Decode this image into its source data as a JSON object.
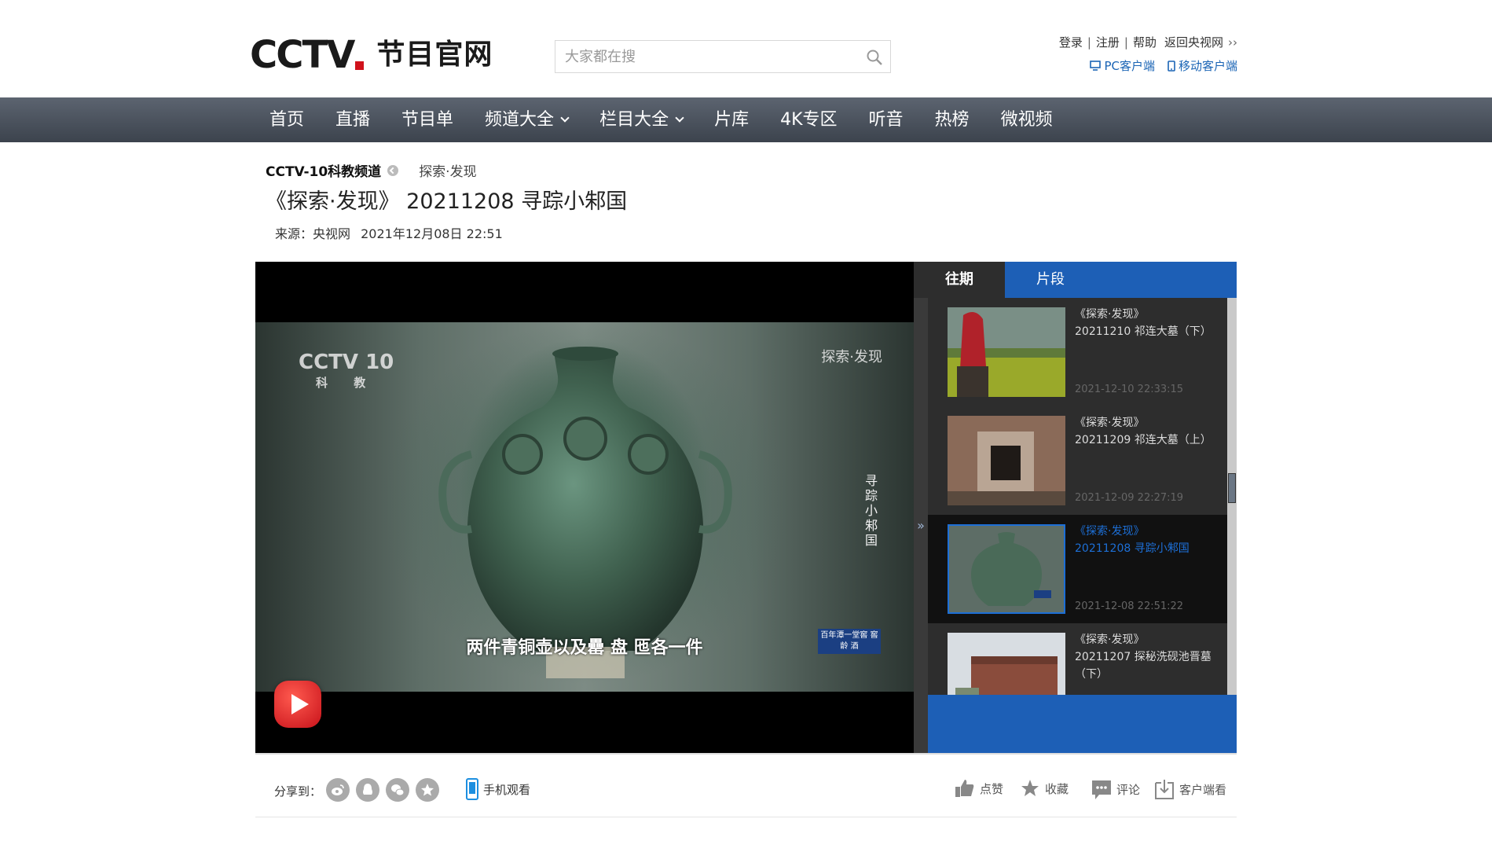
{
  "header": {
    "logo_text": "CCTV",
    "logo_sub": "节目官网",
    "search_placeholder": "大家都在搜",
    "links": {
      "login": "登录",
      "register": "注册",
      "help": "帮助",
      "back": "返回央视网"
    },
    "client_links": {
      "pc": "PC客户端",
      "mobile": "移动客户端"
    }
  },
  "nav": {
    "items": [
      {
        "label": "首页",
        "dropdown": false
      },
      {
        "label": "直播",
        "dropdown": false
      },
      {
        "label": "节目单",
        "dropdown": false
      },
      {
        "label": "频道大全",
        "dropdown": true
      },
      {
        "label": "栏目大全",
        "dropdown": true
      },
      {
        "label": "片库",
        "dropdown": false
      },
      {
        "label": "4K专区",
        "dropdown": false
      },
      {
        "label": "听音",
        "dropdown": false
      },
      {
        "label": "热榜",
        "dropdown": false
      },
      {
        "label": "微视频",
        "dropdown": false
      }
    ]
  },
  "page": {
    "channel": "CCTV-10科教频道",
    "column": "探索·发现",
    "title": "《探索·发现》 20211208 寻踪小邾国",
    "source": "来源：央视网",
    "date": "2021年12月08日 22:51"
  },
  "video": {
    "channel_logo": "CCTV 10",
    "channel_logo_sub": "科 教",
    "program_logo": "探索·发现",
    "vertical_title": "寻踪小邾国",
    "subtitle": "两件青铜壶以及罍 盘 匜各一件",
    "ad_text": "百年潭一堂窖 窖 龄 酒"
  },
  "sidebar": {
    "tabs": [
      {
        "label": "往期",
        "active": true
      },
      {
        "label": "片段",
        "active": false
      }
    ],
    "episodes": [
      {
        "series": "《探索·发现》",
        "title": "20211210 祁连大墓（下）",
        "time": "2021-12-10 22:33:15",
        "active": false
      },
      {
        "series": "《探索·发现》",
        "title": "20211209 祁连大墓（上）",
        "time": "2021-12-09 22:27:19",
        "active": false
      },
      {
        "series": "《探索·发现》",
        "title": "20211208 寻踪小邾国",
        "time": "2021-12-08 22:51:22",
        "active": true
      },
      {
        "series": "《探索·发现》",
        "title": "20211207 探秘洗砚池晋墓（下）",
        "time": "",
        "active": false
      }
    ]
  },
  "share": {
    "label": "分享到：",
    "mobile_watch": "手机观看",
    "actions": {
      "like": "点赞",
      "favorite": "收藏",
      "comment": "评论",
      "client": "客户端看"
    }
  },
  "colors": {
    "accent_blue": "#1d5fb6",
    "nav_bg": "#4a515b",
    "brand_red": "#d0121b"
  }
}
